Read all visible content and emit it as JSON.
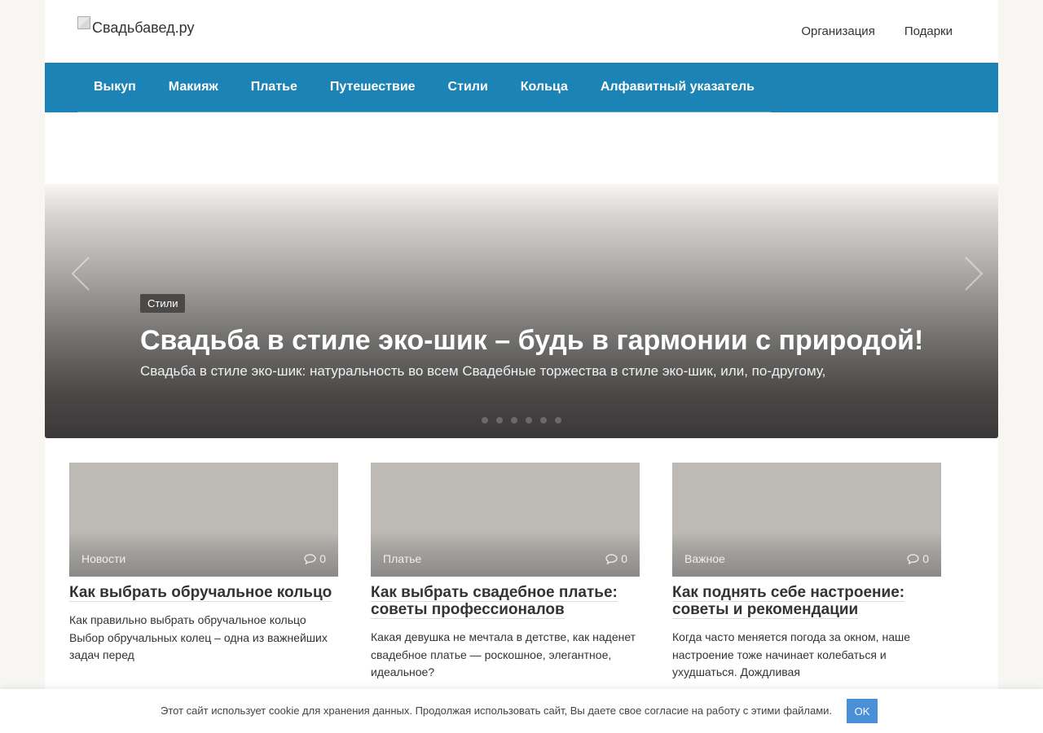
{
  "header": {
    "logo_alt": "Свадьбавед.ру",
    "top_links": [
      "Организация",
      "Подарки"
    ]
  },
  "nav": {
    "items": [
      "Выкуп",
      "Макияж",
      "Платье",
      "Путешествие",
      "Стили",
      "Кольца",
      "Алфавитный указатель"
    ]
  },
  "slider": {
    "category": "Стили",
    "title": "Свадьба в стиле эко-шик – будь в гармонии с природой!",
    "excerpt": "Свадьба в стиле эко-шик: натуральность во всем Свадебные торжества в стиле эко-шик, или, по-другому,",
    "dot_count": 6
  },
  "cards": [
    {
      "category": "Новости",
      "comments": "0",
      "title": "Как выбрать обручальное кольцо",
      "excerpt": "Как правильно выбрать обручальное кольцо Выбор обручальных колец – одна из важнейших задач перед"
    },
    {
      "category": "Платье",
      "comments": "0",
      "title": "Как выбрать свадебное платье: советы профессионалов",
      "excerpt": "Какая девушка не мечтала в детстве, как наденет свадебное платье — роскошное, элегантное, идеальное?"
    },
    {
      "category": "Важное",
      "comments": "0",
      "title": "Как поднять себе настроение: советы и рекомендации",
      "excerpt": "Когда часто меняется погода за окном, наше настроение тоже начинает колебаться и ухудшаться. Дождливая"
    }
  ],
  "cookie": {
    "text": "Этот сайт использует cookie для хранения данных. Продолжая использовать сайт, Вы даете свое согласие на работу с этими файлами.",
    "ok_label": "OK"
  }
}
